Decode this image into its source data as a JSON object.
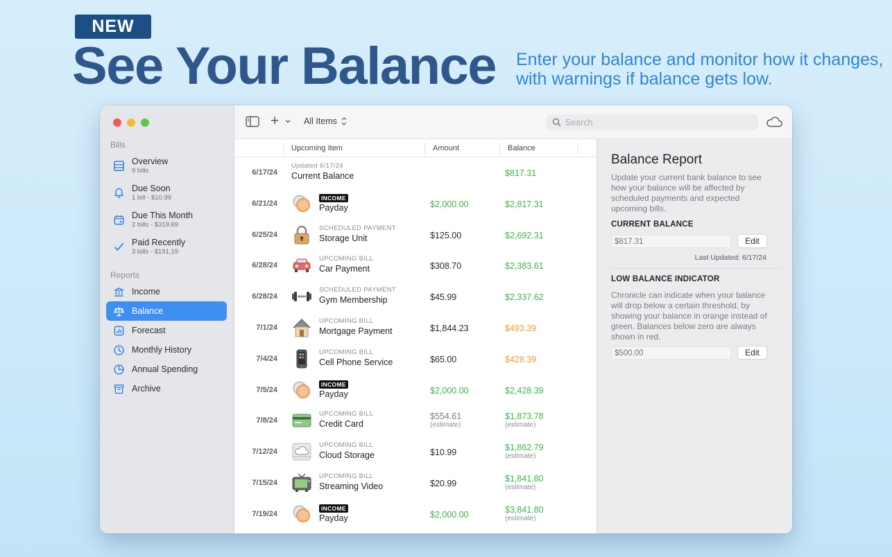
{
  "promo": {
    "badge": "NEW",
    "title": "See Your Balance",
    "subtitle": "Enter your balance and monitor how it changes, with warnings if balance gets low."
  },
  "colors": {
    "accent": "#3d8ff2",
    "green": "#3bb44a",
    "orange": "#f29a2e",
    "title_blue": "#2f578c",
    "subtitle_blue": "#2f86d6"
  },
  "sidebar": {
    "bills_header": "Bills",
    "bills": [
      {
        "label": "Overview",
        "sub": "9 bills",
        "icon": "list-icon"
      },
      {
        "label": "Due Soon",
        "sub": "1 bill - $10.99",
        "icon": "bell-icon"
      },
      {
        "label": "Due This Month",
        "sub": "2 bills - $319.69",
        "icon": "calendar-icon"
      },
      {
        "label": "Paid Recently",
        "sub": "3 bills - $191.19",
        "icon": "checkmark-icon"
      }
    ],
    "reports_header": "Reports",
    "reports": [
      {
        "label": "Income",
        "icon": "bank-icon"
      },
      {
        "label": "Balance",
        "icon": "scale-icon",
        "active": true
      },
      {
        "label": "Forecast",
        "icon": "chart-icon"
      },
      {
        "label": "Monthly History",
        "icon": "clock-icon"
      },
      {
        "label": "Annual Spending",
        "icon": "pie-icon"
      },
      {
        "label": "Archive",
        "icon": "archive-icon"
      }
    ]
  },
  "toolbar": {
    "filter": "All Items",
    "search_placeholder": "Search"
  },
  "table": {
    "columns": {
      "item": "Upcoming Item",
      "amount": "Amount",
      "balance": "Balance"
    },
    "rows": [
      {
        "date": "6/17/24",
        "kicker": "Updated 6/17/24",
        "name": "Current Balance",
        "amount": "",
        "balance": "$817.31",
        "balance_color": "green",
        "icon": ""
      },
      {
        "date": "6/21/24",
        "kicker": "INCOME",
        "name": "Payday",
        "amount": "$2,000.00",
        "amount_color": "green",
        "balance": "$2,817.31",
        "balance_color": "green",
        "icon": "coins-icon"
      },
      {
        "date": "6/25/24",
        "kicker": "SCHEDULED PAYMENT",
        "name": "Storage Unit",
        "amount": "$125.00",
        "amount_color": "dark",
        "balance": "$2,692.31",
        "balance_color": "green",
        "icon": "padlock-icon"
      },
      {
        "date": "6/28/24",
        "kicker": "UPCOMING BILL",
        "name": "Car Payment",
        "amount": "$308.70",
        "amount_color": "dark",
        "balance": "$2,383.61",
        "balance_color": "green",
        "icon": "car-icon"
      },
      {
        "date": "6/28/24",
        "kicker": "SCHEDULED PAYMENT",
        "name": "Gym Membership",
        "amount": "$45.99",
        "amount_color": "dark",
        "balance": "$2,337.62",
        "balance_color": "green",
        "icon": "dumbbell-icon"
      },
      {
        "date": "7/1/24",
        "kicker": "UPCOMING BILL",
        "name": "Mortgage Payment",
        "amount": "$1,844.23",
        "amount_color": "dark",
        "balance": "$493.39",
        "balance_color": "orange",
        "icon": "house-icon"
      },
      {
        "date": "7/4/24",
        "kicker": "UPCOMING BILL",
        "name": "Cell Phone Service",
        "amount": "$65.00",
        "amount_color": "dark",
        "balance": "$428.39",
        "balance_color": "orange",
        "icon": "phone-icon"
      },
      {
        "date": "7/5/24",
        "kicker": "INCOME",
        "name": "Payday",
        "amount": "$2,000.00",
        "amount_color": "green",
        "balance": "$2,428.39",
        "balance_color": "green",
        "icon": "coins-icon"
      },
      {
        "date": "7/8/24",
        "kicker": "UPCOMING BILL",
        "name": "Credit Card",
        "amount": "$554.61",
        "amount_color": "grey",
        "amount_note": "(estimate)",
        "balance": "$1,873.78",
        "balance_color": "green",
        "balance_note": "(estimate)",
        "icon": "credit-card-icon"
      },
      {
        "date": "7/12/24",
        "kicker": "UPCOMING BILL",
        "name": "Cloud Storage",
        "amount": "$10.99",
        "amount_color": "dark",
        "balance": "$1,862.79",
        "balance_color": "green",
        "balance_note": "(estimate)",
        "icon": "cloud-drive-icon"
      },
      {
        "date": "7/15/24",
        "kicker": "UPCOMING BILL",
        "name": "Streaming Video",
        "amount": "$20.99",
        "amount_color": "dark",
        "balance": "$1,841.80",
        "balance_color": "green",
        "balance_note": "(estimate)",
        "icon": "tv-icon"
      },
      {
        "date": "7/19/24",
        "kicker": "INCOME",
        "name": "Payday",
        "amount": "$2,000.00",
        "amount_color": "green",
        "balance": "$3,841.80",
        "balance_color": "green",
        "balance_note": "(estimate)",
        "icon": "coins-icon"
      }
    ]
  },
  "report": {
    "title": "Balance Report",
    "description": "Update your current bank balance to see how your balance will be affected by scheduled payments and expected upcoming bills.",
    "current_balance_heading": "CURRENT BALANCE",
    "current_balance_placeholder": "$817.31",
    "edit_label": "Edit",
    "last_updated": "Last Updated: 6/17/24",
    "low_balance_heading": "LOW BALANCE INDICATOR",
    "low_balance_description": "Chronicle can indicate when your balance will drop below a certain threshold, by showing your balance in orange instead of green. Balances below zero are always shown in red.",
    "low_balance_placeholder": "$500.00"
  }
}
